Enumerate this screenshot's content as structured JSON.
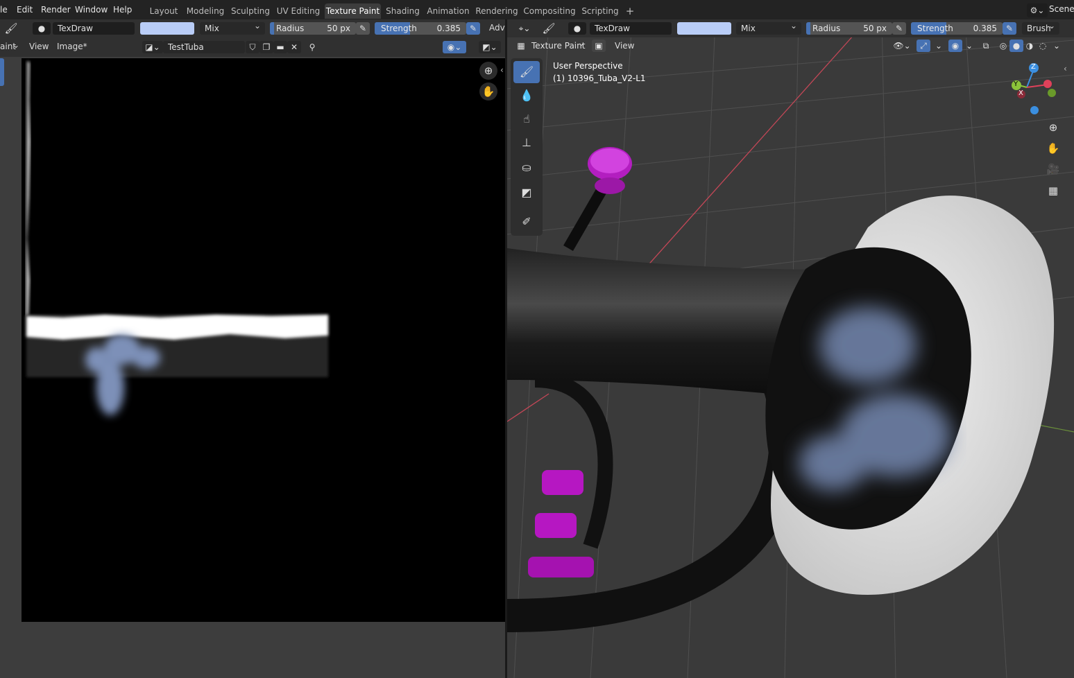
{
  "menu": {
    "file": "le",
    "edit": "Edit",
    "render": "Render",
    "window": "Window",
    "help": "Help"
  },
  "workspaces": [
    "Layout",
    "Modeling",
    "Sculpting",
    "UV Editing",
    "Texture Paint",
    "Shading",
    "Animation",
    "Rendering",
    "Compositing",
    "Scripting"
  ],
  "active_workspace": "Texture Paint",
  "add_workspace": "+",
  "scene_label": "Scene",
  "left_tool": {
    "brush_name": "TexDraw",
    "blend": "Mix",
    "radius_label": "Radius",
    "radius_value": "50 px",
    "strength_label": "Strength",
    "strength_value": "0.385",
    "strength_fraction": 0.385,
    "advanced_label": "Adva",
    "color": "#b9cdf7"
  },
  "image_editor": {
    "mode_label": "aint",
    "view_label": "View",
    "image_label": "Image*",
    "image_name": "TestTuba"
  },
  "right_tool": {
    "brush_name": "TexDraw",
    "blend": "Mix",
    "radius_label": "Radius",
    "radius_value": "50 px",
    "strength_label": "Strength",
    "strength_value": "0.385",
    "strength_fraction": 0.385,
    "brush_menu": "Brush"
  },
  "viewport": {
    "mode_label": "Texture Paint",
    "view_label": "View",
    "perspective_label": "User Perspective",
    "object_label": "(1) 10396_Tuba_V2-L1"
  },
  "gizmo": {
    "z": "Z",
    "y": "Y",
    "x": "X"
  },
  "icons": [
    "brush-icon",
    "zoom-icon",
    "hand-icon",
    "camera-icon",
    "grid-icon",
    "draw-tool-icon",
    "soften-tool-icon",
    "smear-tool-icon",
    "clone-tool-icon",
    "fill-tool-icon",
    "mask-tool-icon",
    "annotate-tool-icon",
    "pin-icon",
    "shield-icon",
    "folder-icon",
    "close-icon"
  ],
  "colors": {
    "accent": "#4772b3",
    "brush_color": "#b9cdf7",
    "valve_magenta": "#c41fd0",
    "x_axis": "#e0415a",
    "y_axis": "#8bc43a",
    "z_axis": "#3b8fe0"
  }
}
